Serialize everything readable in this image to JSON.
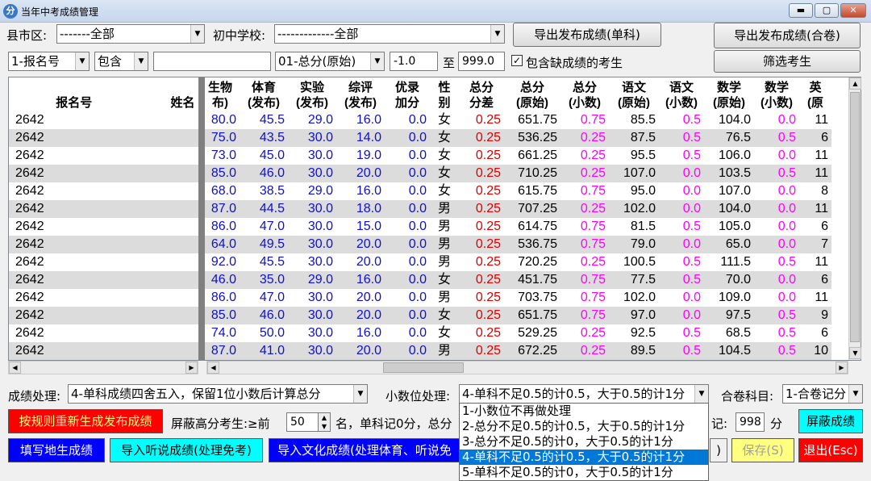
{
  "window": {
    "title": "当年中考成绩管理",
    "icon_glyph": "分",
    "min": "▬",
    "max": "▢",
    "close": "✕"
  },
  "filters": {
    "county_label": "县市区:",
    "county_value": "-------全部",
    "school_label": "初中学校:",
    "school_value": "-------------全部",
    "field_value": "1-报名号",
    "op_value": "包含",
    "text_value": "",
    "score_field_value": "01-总分(原始)",
    "range_from": "-1.0",
    "range_sep": "至",
    "range_to": "999.0",
    "include_missing_label": "包含缺成绩的考生",
    "include_missing_check": "✓"
  },
  "buttons": {
    "export_single": "导出发布成绩(单科)",
    "export_combined": "导出发布成绩(合卷)",
    "filter": "筛选考生",
    "regenerate": "按规则重新生成发布成绩",
    "shield_btn": "屏蔽成绩",
    "fill_local": "填写地生成绩",
    "import_listen": "导入听说成绩(处理免考)",
    "import_culture": "导入文化成绩(处理体育、听说免",
    "hidden_right": ")",
    "save": "保存(S)",
    "exit": "退出(Esc)"
  },
  "options": {
    "score_proc_label": "成绩处理:",
    "score_proc_value": "4-单科成绩四舍五入，保留1位小数后计算总分",
    "decimal_label": "小数位处理:",
    "decimal_value": "4-单科不足0.5的计0.5，大于0.5的计1分",
    "combined_label": "合卷科目:",
    "combined_value": "1-合卷记分",
    "shield_label": "屏蔽高分考生:≥前",
    "shield_value": "50",
    "shield_text": "名，单科记0分，总分",
    "mark_label": "记:",
    "mark_value": "998",
    "mark_unit": "分"
  },
  "dropdown": [
    "1-小数位不再做处理",
    "2-总分不足0.5的计0.5，大于0.5的计1分",
    "3-总分不足0.5的计0，大于0.5的计1分",
    "4-单科不足0.5的计0.5，大于0.5的计1分",
    "5-单科不足0.5的计0，大于0.5的计1分"
  ],
  "dropdown_selected": 3,
  "table": {
    "columns": [
      {
        "h1": "",
        "h2": "报名号"
      },
      {
        "h1": "",
        "h2": "姓名"
      },
      {
        "h1": "生物",
        "h2": "布)"
      },
      {
        "h1": "体育",
        "h2": "(发布)"
      },
      {
        "h1": "实验",
        "h2": "(发布)"
      },
      {
        "h1": "综评",
        "h2": "(发布)"
      },
      {
        "h1": "优录",
        "h2": "加分"
      },
      {
        "h1": "性",
        "h2": "别"
      },
      {
        "h1": "总分",
        "h2": "分差"
      },
      {
        "h1": "总分",
        "h2": "(原始)"
      },
      {
        "h1": "总分",
        "h2": "(小数)"
      },
      {
        "h1": "语文",
        "h2": "(原始)"
      },
      {
        "h1": "语文",
        "h2": "(小数)"
      },
      {
        "h1": "数学",
        "h2": "(原始)"
      },
      {
        "h1": "数学",
        "h2": "(小数)"
      },
      {
        "h1": "英",
        "h2": "(原"
      }
    ],
    "rows": [
      [
        "2642",
        "",
        "80.0",
        "45.5",
        "29.0",
        "16.0",
        "0.0",
        "女",
        "0.25",
        "651.75",
        "0.75",
        "85.5",
        "0.5",
        "104.0",
        "0.0",
        "11"
      ],
      [
        "2642",
        "",
        "75.0",
        "43.5",
        "30.0",
        "14.0",
        "0.0",
        "女",
        "0.25",
        "536.25",
        "0.25",
        "87.5",
        "0.5",
        "76.5",
        "0.5",
        "6"
      ],
      [
        "2642",
        "",
        "73.0",
        "45.0",
        "30.0",
        "19.0",
        "0.0",
        "女",
        "0.25",
        "661.25",
        "0.25",
        "95.5",
        "0.5",
        "106.0",
        "0.0",
        "11"
      ],
      [
        "2642",
        "",
        "85.0",
        "46.0",
        "30.0",
        "20.0",
        "0.0",
        "女",
        "0.25",
        "710.25",
        "0.25",
        "107.0",
        "0.0",
        "103.5",
        "0.5",
        "11"
      ],
      [
        "2642",
        "",
        "68.0",
        "38.5",
        "29.0",
        "16.0",
        "0.0",
        "女",
        "0.25",
        "615.75",
        "0.75",
        "95.0",
        "0.0",
        "107.0",
        "0.0",
        "8"
      ],
      [
        "2642",
        "",
        "87.0",
        "44.5",
        "30.0",
        "18.0",
        "0.0",
        "男",
        "0.25",
        "707.25",
        "0.25",
        "102.0",
        "0.0",
        "104.0",
        "0.0",
        "11"
      ],
      [
        "2642",
        "",
        "86.0",
        "47.0",
        "30.0",
        "15.0",
        "0.0",
        "男",
        "0.25",
        "614.75",
        "0.75",
        "81.5",
        "0.5",
        "105.0",
        "0.0",
        "6"
      ],
      [
        "2642",
        "",
        "64.0",
        "49.5",
        "30.0",
        "20.0",
        "0.0",
        "男",
        "0.25",
        "536.75",
        "0.75",
        "79.0",
        "0.0",
        "65.0",
        "0.0",
        "7"
      ],
      [
        "2642",
        "",
        "92.0",
        "45.5",
        "30.0",
        "20.0",
        "0.0",
        "男",
        "0.25",
        "720.25",
        "0.25",
        "100.5",
        "0.5",
        "111.5",
        "0.5",
        "11"
      ],
      [
        "2642",
        "",
        "46.0",
        "35.0",
        "29.0",
        "16.0",
        "0.0",
        "女",
        "0.25",
        "451.75",
        "0.75",
        "77.5",
        "0.5",
        "70.0",
        "0.0",
        "6"
      ],
      [
        "2642",
        "",
        "86.0",
        "47.0",
        "30.0",
        "20.0",
        "0.0",
        "男",
        "0.25",
        "703.75",
        "0.75",
        "102.0",
        "0.0",
        "109.0",
        "0.0",
        "11"
      ],
      [
        "2642",
        "",
        "85.0",
        "46.0",
        "30.0",
        "20.0",
        "0.0",
        "女",
        "0.25",
        "651.75",
        "0.75",
        "97.0",
        "0.0",
        "97.5",
        "0.5",
        "9"
      ],
      [
        "2642",
        "",
        "74.0",
        "50.0",
        "30.0",
        "16.0",
        "0.0",
        "女",
        "0.25",
        "529.25",
        "0.25",
        "92.5",
        "0.5",
        "68.5",
        "0.5",
        "6"
      ],
      [
        "2642",
        "",
        "87.0",
        "41.0",
        "30.0",
        "20.0",
        "0.0",
        "男",
        "0.25",
        "672.25",
        "0.25",
        "89.5",
        "0.5",
        "104.5",
        "0.5",
        "10"
      ]
    ]
  },
  "icons": {
    "arrow_down": "▼",
    "arrow_up": "▲",
    "arrow_left": "◀",
    "arrow_right": "▶",
    "spin_up": "▲",
    "spin_down": "▼"
  },
  "colors": {
    "blue": "#1010c8",
    "red": "#e00000",
    "magenta": "#ff00ff",
    "button_red": "#ff0000",
    "button_cyan": "#00ffff",
    "button_blue": "#0000ff",
    "button_yellow": "#ffff80"
  }
}
